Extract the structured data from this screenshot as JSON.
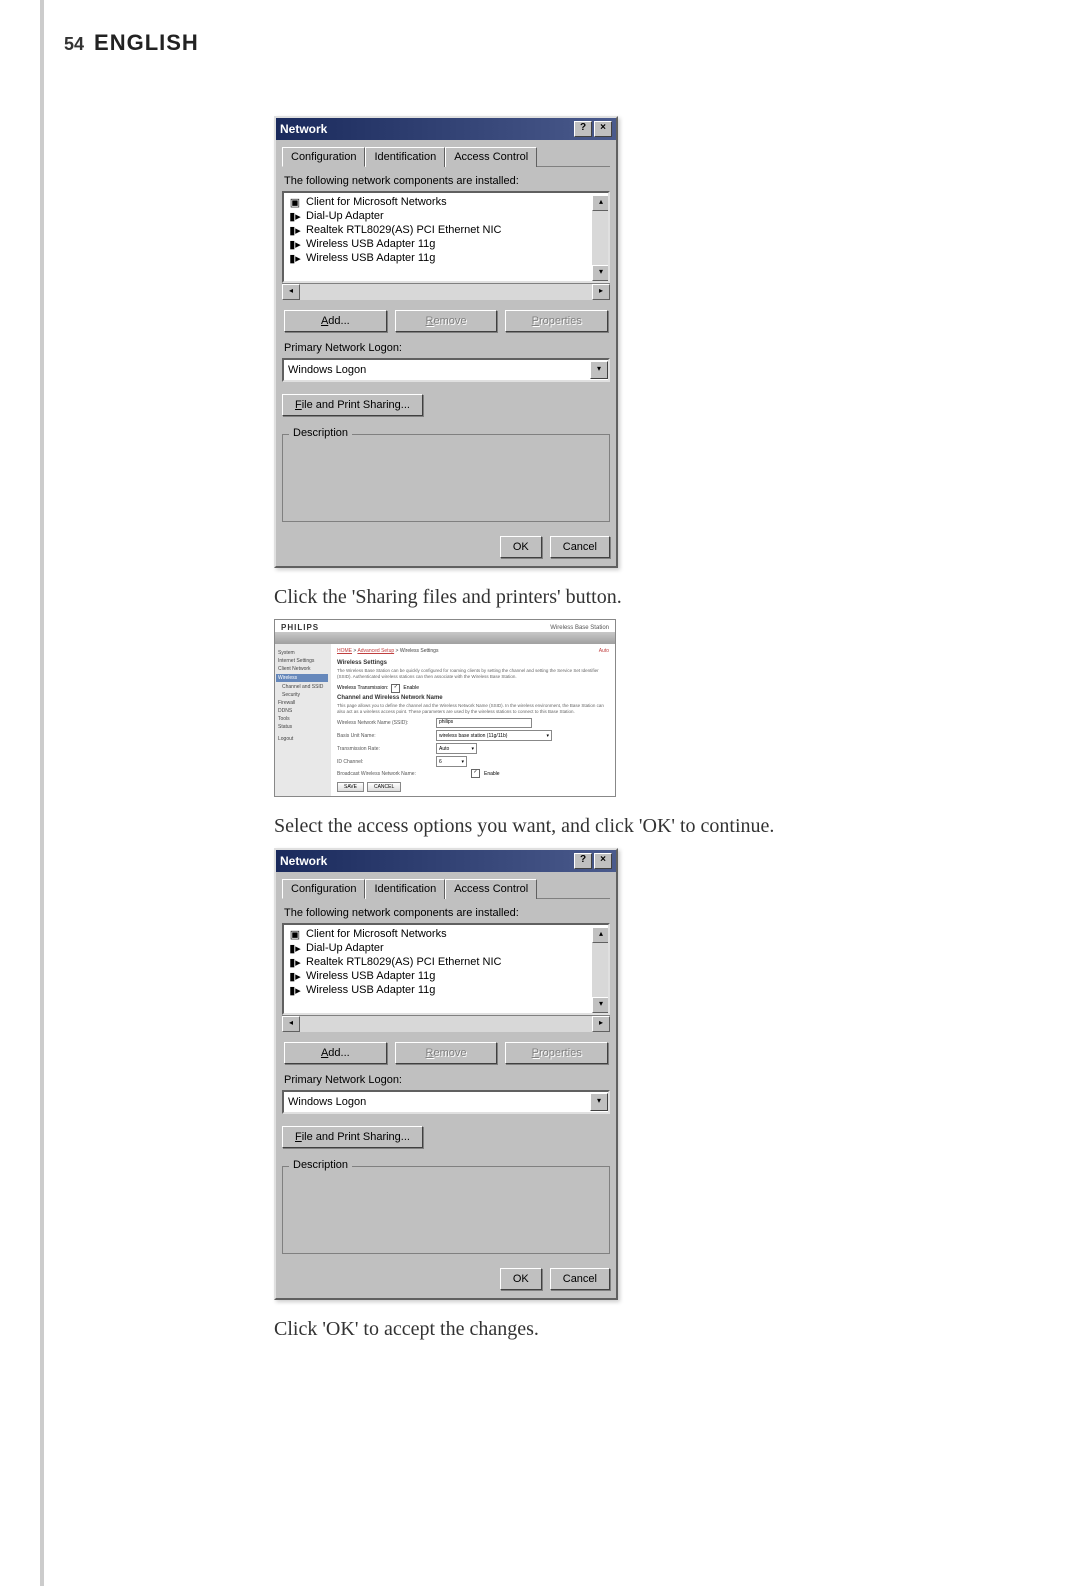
{
  "page": {
    "number": "54",
    "title": "ENGLISH"
  },
  "captions": {
    "share_button": "Click the 'Sharing files and printers' button.",
    "select_access": "Select the access options you want, and click 'OK' to continue.",
    "click_ok": "Click 'OK' to accept the changes."
  },
  "network_dialog": {
    "title": "Network",
    "help_btn": "?",
    "close_btn": "×",
    "tabs": {
      "configuration": "Configuration",
      "identification": "Identification",
      "access_control": "Access Control"
    },
    "components_label": "The following network components are installed:",
    "components": [
      "Client for Microsoft Networks",
      "Dial-Up Adapter",
      "Realtek RTL8029(AS) PCI Ethernet NIC",
      "Wireless USB Adapter 11g",
      "Wireless USB Adapter 11g"
    ],
    "add_btn_prefix": "A",
    "add_btn_rest": "dd...",
    "remove_btn_prefix": "R",
    "remove_btn_rest": "emove",
    "properties_btn_prefix": "P",
    "properties_btn_rest": "roperties",
    "primary_logon_label": "Primary Network Logon:",
    "primary_logon_value": "Windows Logon",
    "file_print_btn_prefix": "F",
    "file_print_btn_rest": "ile and Print Sharing...",
    "description_label": "Description",
    "ok_btn": "OK",
    "cancel_btn": "Cancel"
  },
  "web_ui": {
    "logo": "PHILIPS",
    "brand": "Wireless Base Station",
    "auto": "Auto",
    "breadcrumb_home": "HOME",
    "breadcrumb_sep": " > ",
    "breadcrumb_as": "Advanced Setup",
    "breadcrumb_ws": " > Wireless Settings",
    "sidebar": {
      "system": "System",
      "internet_settings": "Internet Settings",
      "client_network": "Client Network",
      "wireless": "Wireless",
      "channel_ssid": "Channel and SSID",
      "security": "Security",
      "firewall": "Firewall",
      "ddns": "DDNS",
      "tools": "Tools",
      "status": "Status",
      "logout": "Logout"
    },
    "section_title": "Wireless Settings",
    "para1": "The Wireless Base Station can be quickly configured for roaming clients by setting the channel and setting the Service Set Identifier (SSID). Authenticated wireless stations can then associate with the Wireless Base Station.",
    "checkbox_enable": "Wireless Transmission:",
    "checkbox_enable_value": "Enable",
    "subsection_title": "Channel and Wireless Network Name",
    "para2": "This page allows you to define the channel and the Wireless Network Name (SSID). In the wireless environment, the Base Station can also act as a wireless access point. These parameters are used by the wireless stations to connect to this Base Station.",
    "fields": {
      "wnn_label": "Wireless Network Name (SSID):",
      "wnn_value": "philips",
      "basis_label": "Basis Unit Name:",
      "basis_value": "wireless base station (11g/11b)",
      "transmission_label": "Transmission Rate:",
      "transmission_value": "Auto",
      "channel_label": "ID Channel:",
      "channel_value": "6",
      "broadcast_label": "Broadcast Wireless Network Name:",
      "broadcast_value": "Enable"
    },
    "save_btn": "SAVE",
    "cancel_btn": "CANCEL"
  }
}
